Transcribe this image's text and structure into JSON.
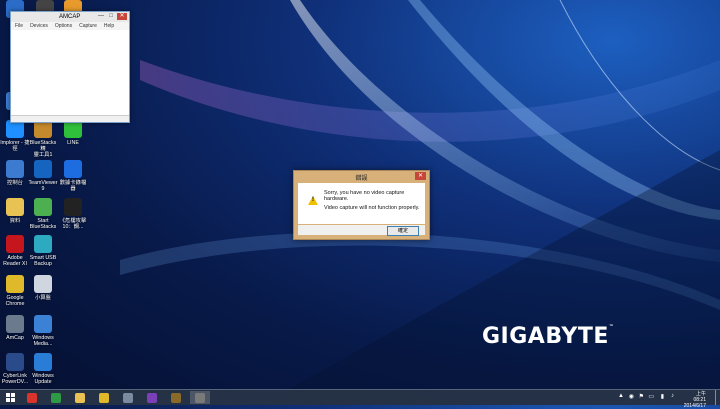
{
  "brand": {
    "name": "GIGABYTE",
    "mark": "™"
  },
  "desktop_icons": [
    {
      "label": "",
      "name": "icon-top-left-1",
      "color": "#2a6cc7"
    },
    {
      "label": "",
      "name": "icon-top-left-2",
      "color": "#444444"
    },
    {
      "label": "",
      "name": "icon-top-left-3",
      "color": "#e89a2c"
    },
    {
      "label": "實作",
      "name": "icon-partial-1",
      "color": "#3d7bd0"
    },
    {
      "label": "Internet Explorer - 捷徑",
      "display": "lmplorer - 捷\n徑",
      "name": "internet-explorer-icon",
      "color": "#1e90ff"
    },
    {
      "label": "BlueStacks 精靈工具",
      "display": "BlueStacks精\n靈工具1",
      "name": "bluestacks-tool-icon",
      "color": "#c58a2b"
    },
    {
      "label": "LINE",
      "display": "LINE",
      "name": "line-icon",
      "color": "#2fbf3a"
    },
    {
      "label": "控制台",
      "display": "控制台",
      "name": "control-panel-icon",
      "color": "#3d7bd0"
    },
    {
      "label": "TeamViewer 9",
      "display": "TeamViewer\n9",
      "name": "teamviewer-icon",
      "color": "#1565c0"
    },
    {
      "label": "數據卡錄檔器",
      "display": "數據卡錄檔\n器",
      "name": "capture-recorder-icon",
      "color": "#1d6de0"
    },
    {
      "label": "資料",
      "display": "資料",
      "name": "folder-icon",
      "color": "#e8c354"
    },
    {
      "label": "Start BlueStacks",
      "display": "Start\nBlueStacks",
      "name": "start-bluestacks-icon",
      "color": "#4caf50"
    },
    {
      "label": "《危樓攻擊 10 : 鋼...",
      "display": "《危樓攻擊\n10：鋼...",
      "name": "game-shortcut-icon",
      "color": "#222222"
    },
    {
      "label": "Adobe Reader XI",
      "display": "Adobe\nReader XI",
      "name": "adobe-reader-icon",
      "color": "#c4161c"
    },
    {
      "label": "Smart USB Backup",
      "display": "Smart USB\nBackup",
      "name": "smart-usb-backup-icon",
      "color": "#2da9c0"
    },
    {
      "label": "Google Chrome",
      "display": "Google\nChrome",
      "name": "chrome-icon",
      "color": "#e0b92a"
    },
    {
      "label": "小算盤",
      "display": "小算盤",
      "name": "calculator-icon",
      "color": "#cfd6e0"
    },
    {
      "label": "AmCap",
      "display": "AmCap",
      "name": "amcap-icon",
      "color": "#6b7a8c"
    },
    {
      "label": "Windows Media...",
      "display": "Windows\nMedia...",
      "name": "windows-media-icon",
      "color": "#3b82d6"
    },
    {
      "label": "CyberLink PowerDV...",
      "display": "CyberLink\nPowerDV...",
      "name": "cyberlink-icon",
      "color": "#2a4a8a"
    },
    {
      "label": "Windows Update",
      "display": "Windows\nUpdate",
      "name": "windows-update-icon",
      "color": "#2a7dd6"
    }
  ],
  "amcap_window": {
    "title": "AMCAP",
    "menu": [
      "File",
      "Devices",
      "Options",
      "Capture",
      "Help"
    ],
    "controls": {
      "minimize": "—",
      "maximize": "□",
      "close": "✕"
    }
  },
  "error_dialog": {
    "title": "錯誤",
    "message_line1": "Sorry, you have no video capture hardware.",
    "message_line2": "Video capture will not function properly.",
    "ok_label": "確定",
    "close": "✕"
  },
  "taskbar": {
    "apps": [
      {
        "name": "taskbar-opera-icon",
        "color": "#d9342b"
      },
      {
        "name": "taskbar-store-icon",
        "color": "#2e9a46"
      },
      {
        "name": "taskbar-explorer-icon",
        "color": "#e8c354"
      },
      {
        "name": "taskbar-chrome-icon",
        "color": "#e0b92a"
      },
      {
        "name": "taskbar-media-icon",
        "color": "#7a8aa0"
      },
      {
        "name": "taskbar-vs-icon",
        "color": "#7b3fb8"
      },
      {
        "name": "taskbar-game-icon",
        "color": "#8a6a2a"
      },
      {
        "name": "taskbar-amcap-icon",
        "color": "#7a7a7a"
      }
    ],
    "time": "上午 08:21",
    "date": "2014/6/17"
  }
}
